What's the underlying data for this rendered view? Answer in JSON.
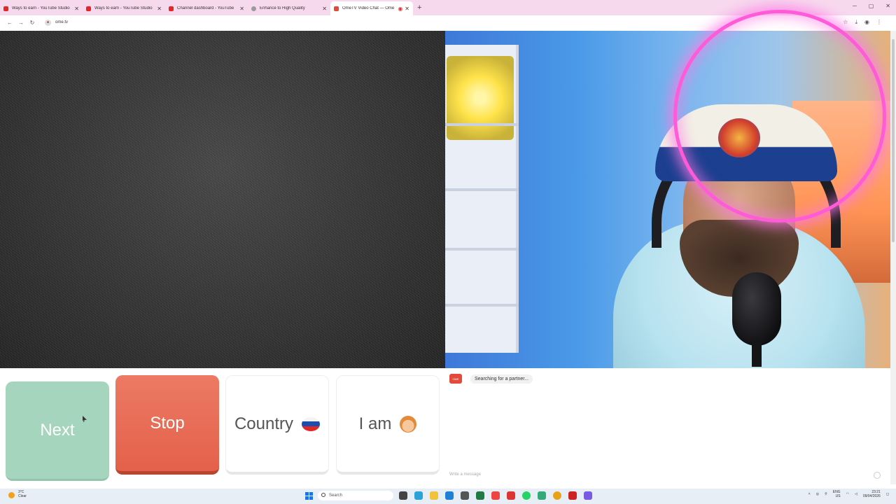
{
  "browser": {
    "tabs": [
      {
        "label": "Ways to earn - YouTube Studio",
        "color": "#e02828",
        "active": false
      },
      {
        "label": "Ways to earn - YouTube Studio",
        "color": "#e02828",
        "active": false
      },
      {
        "label": "Channel dashboard - YouTube",
        "color": "#e02828",
        "active": false
      },
      {
        "label": "Enhance to High Quality",
        "color": "#9a9a9a",
        "active": false
      },
      {
        "label": "OmeTV Video Chat — Ome",
        "color": "#e44a3a",
        "active": true
      }
    ],
    "url": "ome.tv"
  },
  "controls": {
    "next_label": "Next",
    "stop_label": "Stop",
    "country_label": "Country",
    "iam_label": "I am"
  },
  "chat": {
    "status_message": "Searching for a partner...",
    "input_placeholder": "Write a message"
  },
  "taskbar": {
    "weather_temp": "3°C",
    "weather_desc": "Clear",
    "search_placeholder": "Search",
    "lang_top": "ENG",
    "lang_bottom": "US",
    "time": "23:21",
    "date": "09/04/2026"
  },
  "colors": {
    "next": "#9fd2b8",
    "stop": "#e4614a",
    "ring": "#ff5bd9"
  }
}
